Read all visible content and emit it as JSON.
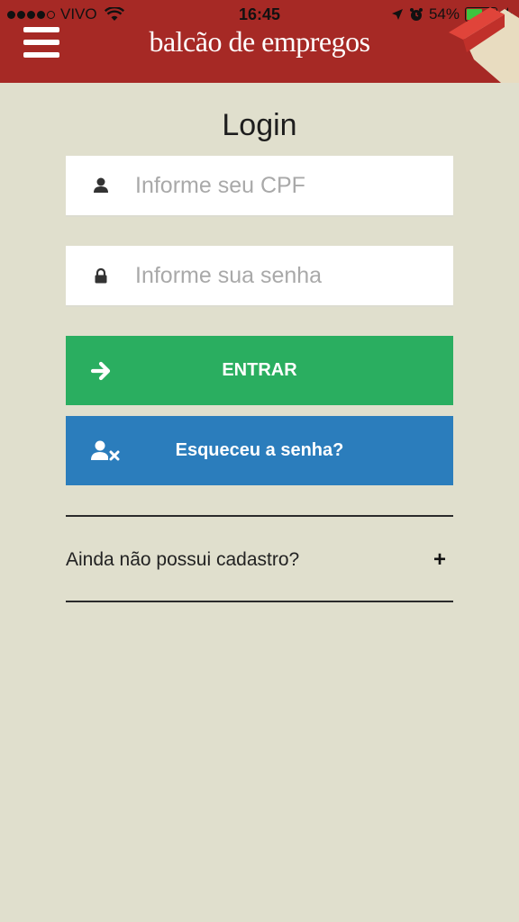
{
  "status_bar": {
    "carrier": "VIVO",
    "time": "16:45",
    "battery": "54%",
    "battery_level": 0.54
  },
  "header": {
    "logo_text": "balcão de empregos",
    "menu_icon": "hamburger-menu-icon",
    "background_color": "#a62925"
  },
  "login": {
    "title": "Login",
    "cpf_placeholder": "Informe seu CPF",
    "cpf_icon": "user-icon",
    "password_placeholder": "Informe sua senha",
    "password_icon": "lock-icon",
    "enter_label": "ENTRAR",
    "enter_icon": "arrow-right-icon",
    "enter_color": "#2aae60",
    "forgot_label": "Esqueceu a senha?",
    "forgot_icon": "user-times-icon",
    "forgot_color": "#2b7dbc",
    "register_label": "Ainda não possui cadastro?",
    "register_icon": "plus-icon"
  }
}
